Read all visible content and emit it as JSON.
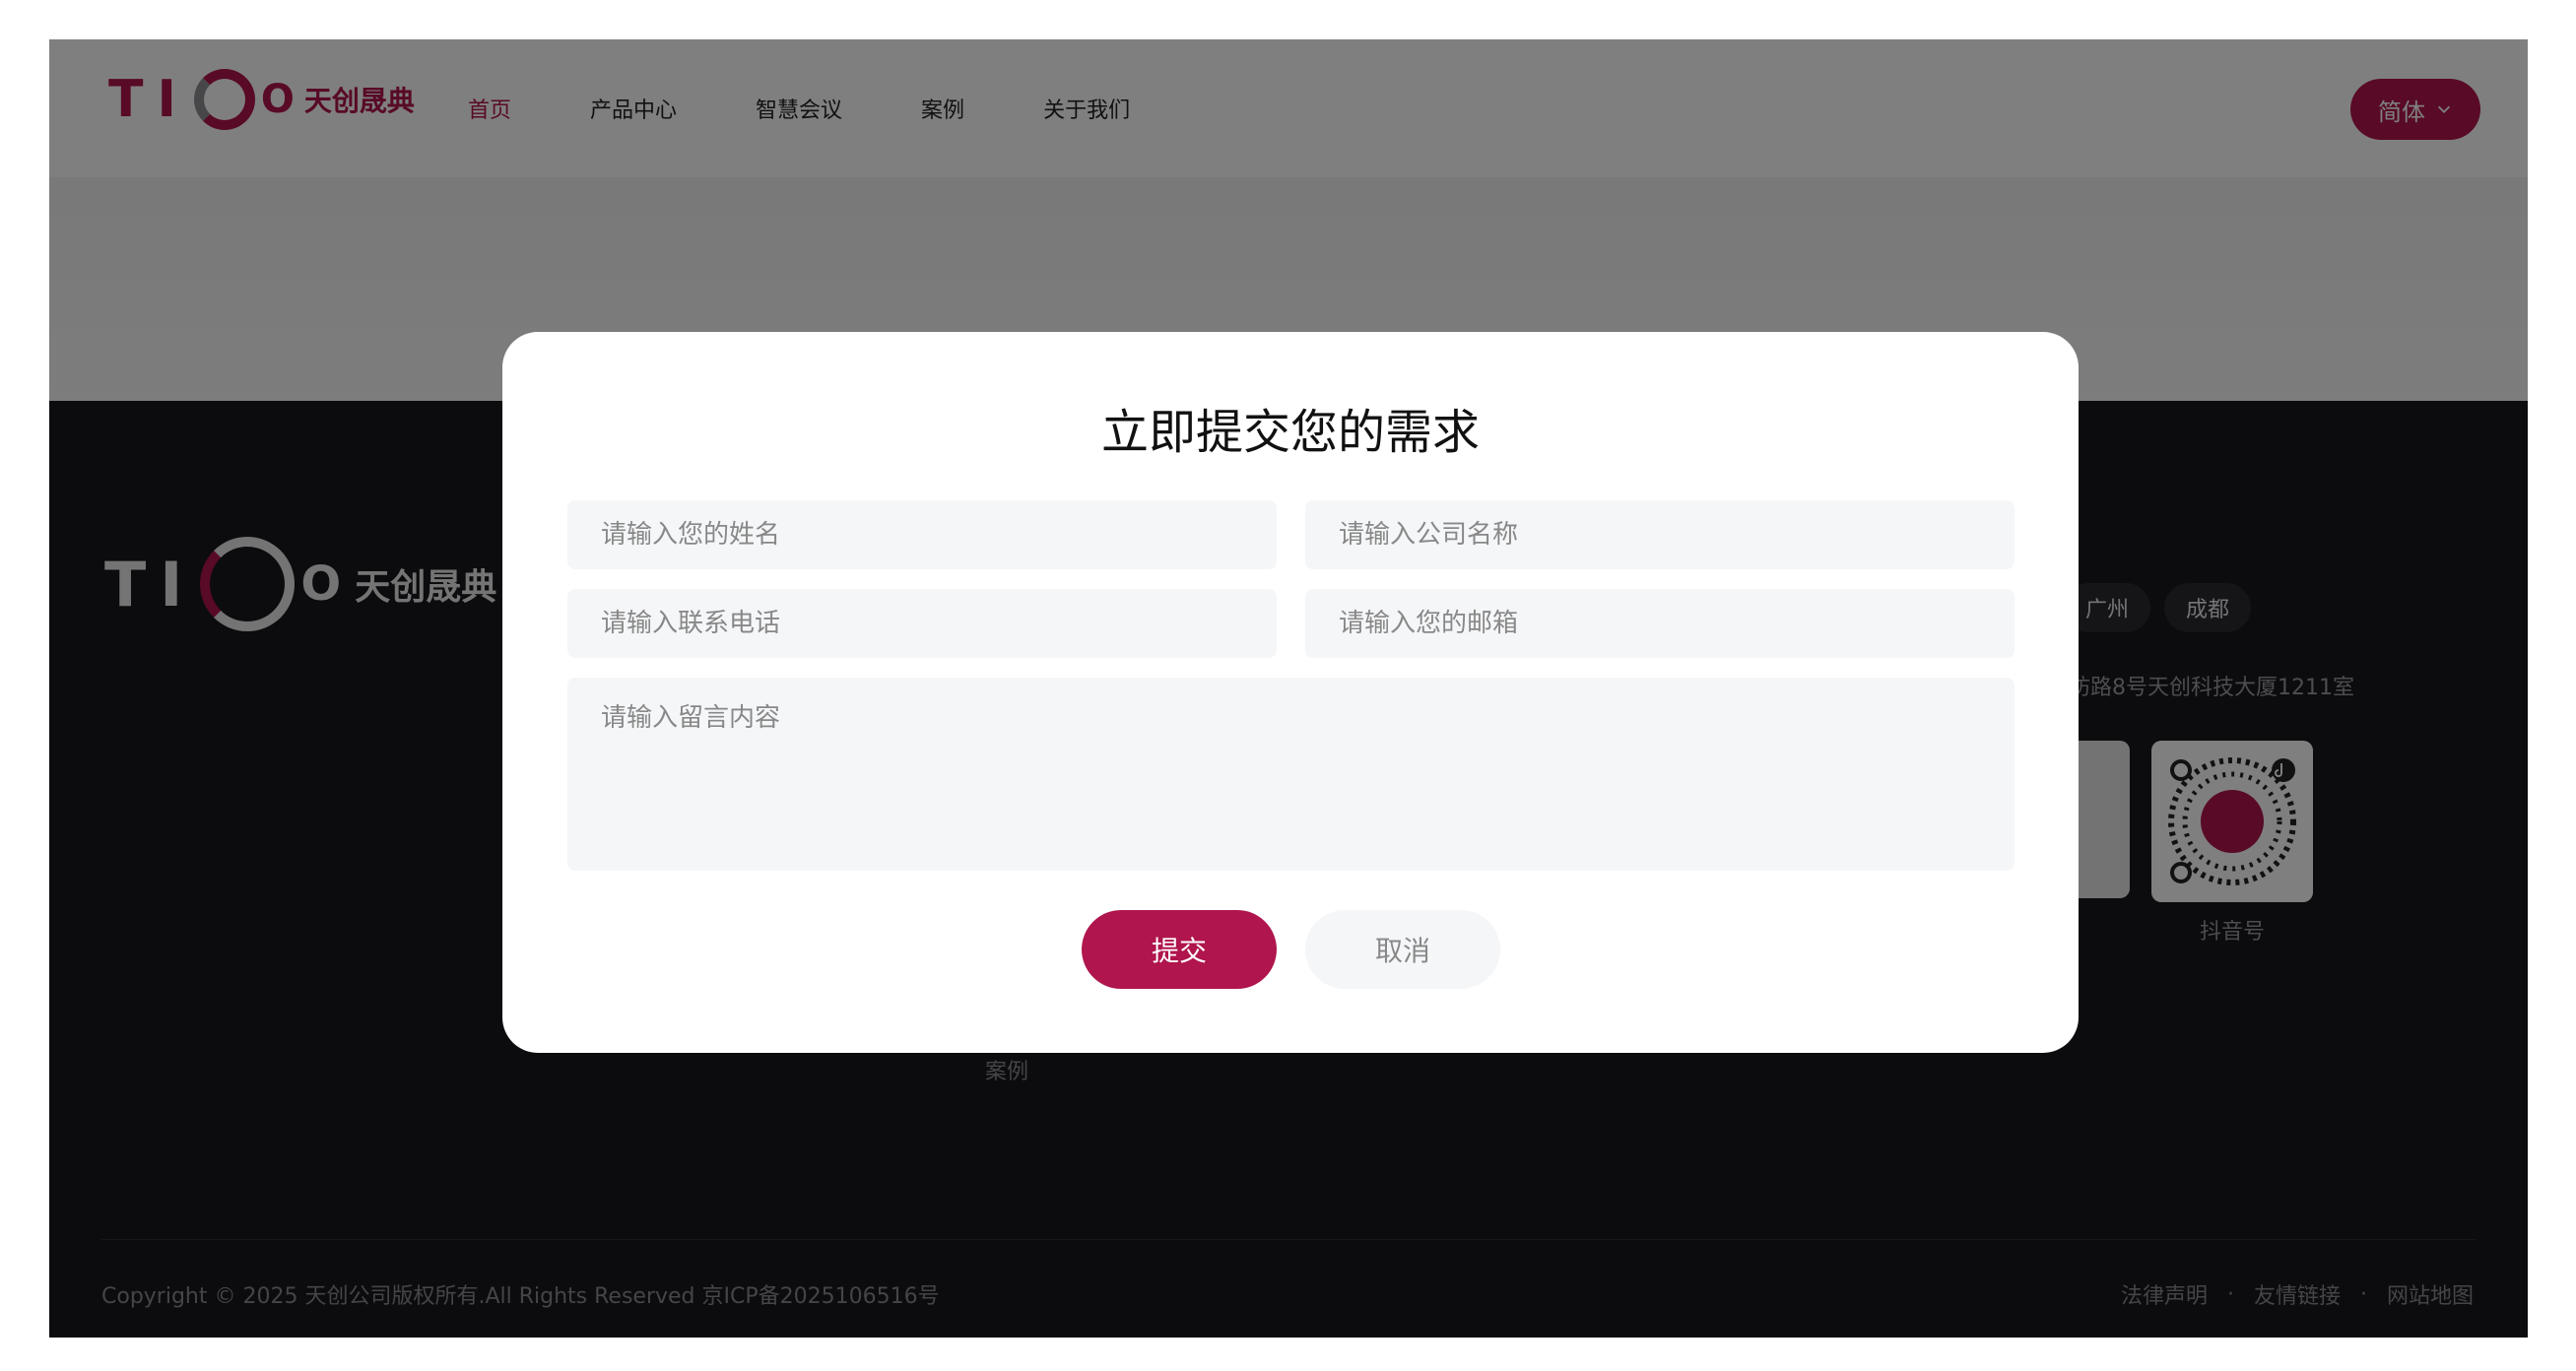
{
  "brand": {
    "mark": "TI",
    "mark_end": "O",
    "name": "天创晟典"
  },
  "nav": {
    "items": [
      {
        "label": "首页",
        "active": true
      },
      {
        "label": "产品中心"
      },
      {
        "label": "智慧会议"
      },
      {
        "label": "案例"
      },
      {
        "label": "关于我们"
      }
    ]
  },
  "lang": {
    "label": "简体",
    "icon": "chevron-down-icon"
  },
  "footer": {
    "nav_case": "案例",
    "cities": [
      "广州",
      "成都"
    ],
    "address": "坊路8号天创科技大厦1211室",
    "qr": {
      "label": "抖音号",
      "icon": "douyin-icon"
    },
    "copyright": "Copyright © 2025 天创公司版权所有.All Rights Reserved 京ICP备2025106516号",
    "links": [
      "法律声明",
      "友情链接",
      "网站地图"
    ],
    "link_sep": "·"
  },
  "modal": {
    "title": "立即提交您的需求",
    "name_placeholder": "请输入您的姓名",
    "company_placeholder": "请输入公司名称",
    "phone_placeholder": "请输入联系电话",
    "email_placeholder": "请输入您的邮箱",
    "message_placeholder": "请输入留言内容",
    "submit_label": "提交",
    "cancel_label": "取消"
  },
  "colors": {
    "accent": "#b0154d",
    "footer_bg": "#18181c",
    "field_bg": "#f5f6f8"
  }
}
